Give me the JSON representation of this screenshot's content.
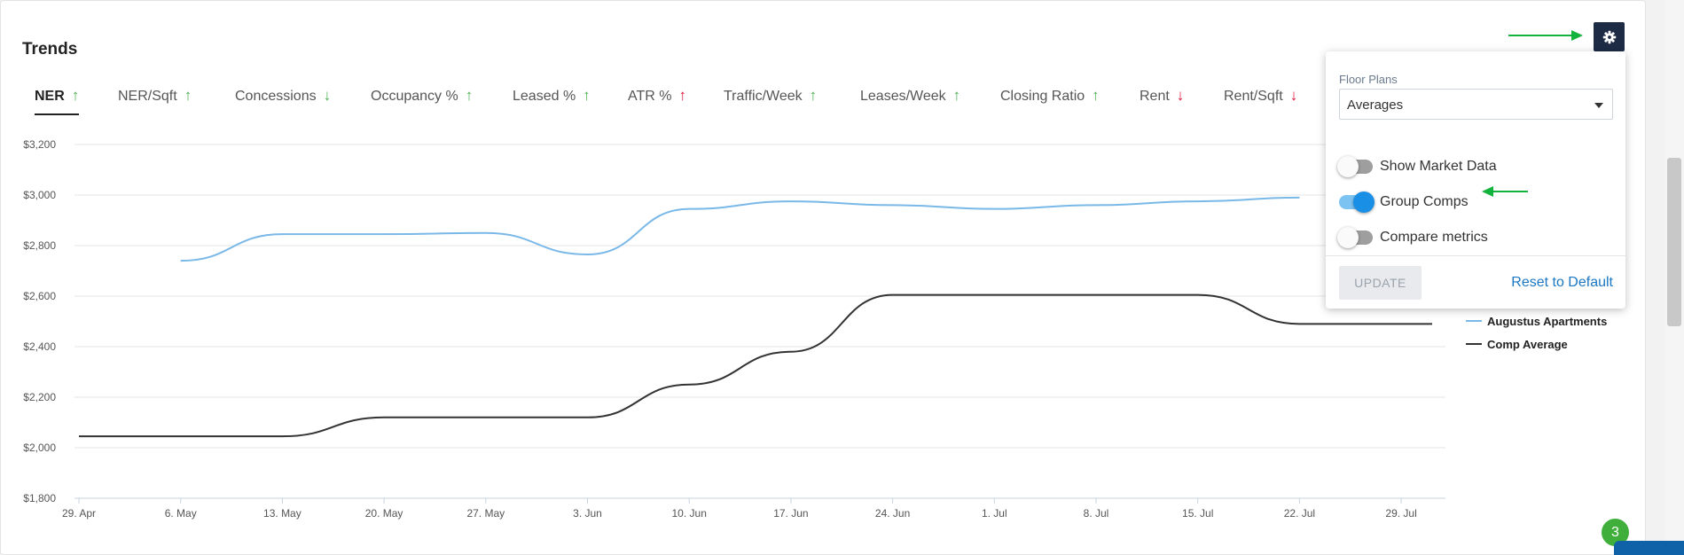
{
  "page": {
    "title": "Trends"
  },
  "tabs": [
    {
      "label": "NER",
      "trend": "up",
      "active": true
    },
    {
      "label": "NER/Sqft",
      "trend": "up"
    },
    {
      "label": "Concessions",
      "trend": "down-green"
    },
    {
      "label": "Occupancy %",
      "trend": "up"
    },
    {
      "label": "Leased %",
      "trend": "up"
    },
    {
      "label": "ATR %",
      "trend": "up-red"
    },
    {
      "label": "Traffic/Week",
      "trend": "up"
    },
    {
      "label": "Leases/Week",
      "trend": "up"
    },
    {
      "label": "Closing Ratio",
      "trend": "up"
    },
    {
      "label": "Rent",
      "trend": "down"
    },
    {
      "label": "Rent/Sqft",
      "trend": "down"
    }
  ],
  "settings_panel": {
    "floor_plans_label": "Floor Plans",
    "floor_plans_value": "Averages",
    "toggles": [
      {
        "label": "Show Market Data",
        "on": false
      },
      {
        "label": "Group Comps",
        "on": true
      },
      {
        "label": "Compare metrics",
        "on": false
      }
    ],
    "update_label": "UPDATE",
    "reset_label": "Reset to Default"
  },
  "badge": {
    "count": "3"
  },
  "colors": {
    "accent": "#1a8fe6",
    "series_a": "#7ab8e8",
    "series_b": "#333333",
    "up": "#4caf50",
    "down": "#e0153a",
    "annotation_arrow": "#12b33c"
  },
  "chart_data": {
    "type": "line",
    "x": [
      "29. Apr",
      "6. May",
      "13. May",
      "20. May",
      "27. May",
      "3. Jun",
      "10. Jun",
      "17. Jun",
      "24. Jun",
      "1. Jul",
      "8. Jul",
      "15. Jul",
      "22. Jul",
      "29. Jul"
    ],
    "y_ticks": [
      "$1,800",
      "$2,000",
      "$2,200",
      "$2,400",
      "$2,600",
      "$2,800",
      "$3,000",
      "$3,200"
    ],
    "ylim": [
      1800,
      3200
    ],
    "grid": true,
    "legend_placement": "right",
    "series": [
      {
        "name": "Augustus Apartments",
        "points": [
          [
            "6. May",
            2740
          ],
          [
            "13. May",
            2845
          ],
          [
            "20. May",
            2845
          ],
          [
            "27. May",
            2850
          ],
          [
            "3. Jun",
            2765
          ],
          [
            "10. Jun",
            2945
          ],
          [
            "17. Jun",
            2975
          ],
          [
            "24. Jun",
            2960
          ],
          [
            "1. Jul",
            2945
          ],
          [
            "8. Jul",
            2960
          ],
          [
            "15. Jul",
            2975
          ],
          [
            "22. Jul",
            2990
          ]
        ]
      },
      {
        "name": "Comp Average",
        "points": [
          [
            "29. Apr",
            2045
          ],
          [
            "6. May",
            2045
          ],
          [
            "13. May",
            2045
          ],
          [
            "20. May",
            2120
          ],
          [
            "27. May",
            2120
          ],
          [
            "3. Jun",
            2120
          ],
          [
            "10. Jun",
            2250
          ],
          [
            "17. Jun",
            2380
          ],
          [
            "24. Jun",
            2605
          ],
          [
            "1. Jul",
            2605
          ],
          [
            "8. Jul",
            2605
          ],
          [
            "15. Jul",
            2605
          ],
          [
            "22. Jul",
            2490
          ],
          [
            "29. Jul",
            2490
          ]
        ]
      }
    ]
  }
}
